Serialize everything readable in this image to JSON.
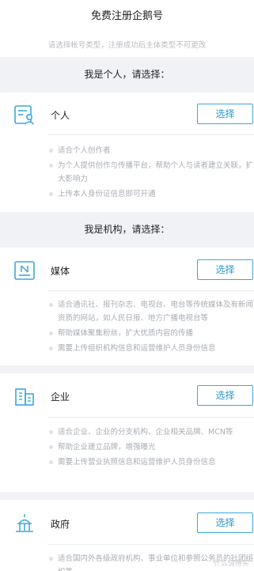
{
  "header": {
    "title": "免费注册企鹅号"
  },
  "subtitle": "请选择帐号类型，注册成功后主体类型不可更改",
  "sections": [
    {
      "heading": "我是个人，请选择："
    },
    {
      "heading": "我是机构，请选择："
    }
  ],
  "cards": [
    {
      "icon": "person-card-icon",
      "title": "个人",
      "button": "选择",
      "bullets": [
        "适合个人创作者",
        "为个人提供创作与传播平台，帮助个人与读者建立关联，扩大影响力",
        "上传本人身份证信息即可开通"
      ]
    },
    {
      "icon": "newspaper-icon",
      "title": "媒体",
      "button": "选择",
      "bullets": [
        "适合通讯社、报刊杂志、电视台、电台等传统媒体及有新闻资质的网站，如人民日报、地方广播电视台等",
        "帮助媒体聚集粉丝，扩大优质内容的传播",
        "需要上传组织机构信息和运营维护人员身份信息"
      ]
    },
    {
      "icon": "building-icon",
      "title": "企业",
      "button": "选择",
      "bullets": [
        "适合企业、企业的分支机构、企业相关品牌、MCN等",
        "帮助企业建立品牌，增强曝光",
        "需要上传营业执照信息和运营维护人员身份信息"
      ]
    },
    {
      "icon": "government-building-icon",
      "title": "政府",
      "button": "选择",
      "bullets": [
        "适合国内外各级政府机构、事业单位和参照公务员的社团组织等"
      ]
    }
  ],
  "colors": {
    "accent": "#2a97cc",
    "section_bg": "#f0f2f5",
    "muted_text": "#a8adb4"
  },
  "watermark": "什么值得买"
}
